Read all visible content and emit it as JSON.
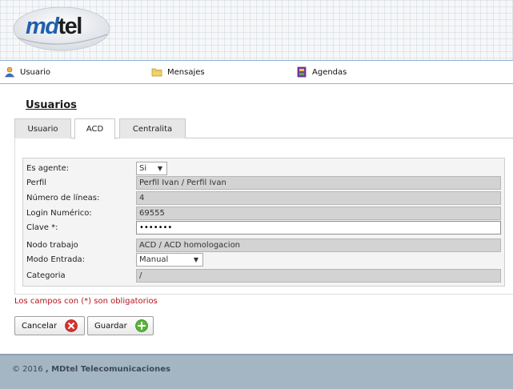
{
  "logo": {
    "text_md": "md",
    "text_tel": "tel"
  },
  "menu": {
    "items": [
      {
        "label": "Usuario",
        "icon": "user-icon"
      },
      {
        "label": "Mensajes",
        "icon": "folder-icon"
      },
      {
        "label": "Agendas",
        "icon": "agenda-book-icon"
      }
    ]
  },
  "page": {
    "title": "Usuarios"
  },
  "tabs": [
    {
      "label": "Usuario",
      "active": false
    },
    {
      "label": "ACD",
      "active": true
    },
    {
      "label": "Centralita",
      "active": false
    }
  ],
  "form": {
    "es_agente": {
      "label": "Es agente:",
      "value": "Si"
    },
    "perfil": {
      "label": "Perfil",
      "value": "Perfil Ivan / Perfil Ivan"
    },
    "numero_lineas": {
      "label": "Número de líneas:",
      "value": "4"
    },
    "login_numerico": {
      "label": "Login Numérico:",
      "value": "69555"
    },
    "clave": {
      "label": "Clave *:",
      "value": "•••••••"
    },
    "nodo_trabajo": {
      "label": "Nodo trabajo",
      "value": "ACD / ACD homologacion"
    },
    "modo_entrada": {
      "label": "Modo Entrada:",
      "value": "Manual"
    },
    "categoria": {
      "label": "Categoria",
      "value": "/"
    }
  },
  "required_note": "Los campos con (*) son obligatorios",
  "buttons": {
    "cancel": {
      "label": "Cancelar",
      "icon": "cancel-x-icon"
    },
    "save": {
      "label": "Guardar",
      "icon": "add-plus-icon"
    }
  },
  "footer": {
    "copyright": "© 2016",
    "company": ", MDtel Telecomunicaciones"
  },
  "colors": {
    "accent_blue": "#1f5fae",
    "required_red": "#b4141a",
    "footer_bg": "#a4b5c3",
    "cancel_icon": "#d9302c",
    "save_icon": "#59b33b"
  }
}
